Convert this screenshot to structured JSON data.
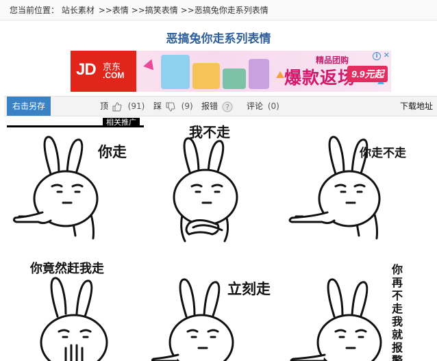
{
  "breadcrumb": {
    "prefix": "您当前位置：",
    "items": [
      "站长素材",
      ">>表情",
      ">>搞笑表情",
      ">>恶搞兔你走系列表情"
    ]
  },
  "page_title": "恶搞兔你走系列表情",
  "ad": {
    "brand_main": "JD",
    "brand_cn": "京东",
    "brand_com": ".COM",
    "slogan_small": "精品团购",
    "slogan_big": "爆款返场",
    "price": "9.9元起"
  },
  "toolbar": {
    "save_label": "右击另存",
    "like_label": "顶",
    "like_count": "(91)",
    "dislike_label": "踩",
    "dislike_count": "(9)",
    "report_label": "报错",
    "comment_label": "评论",
    "comment_count": "(0)",
    "download_label": "下载地址"
  },
  "related_tab": "相关推广",
  "memes": [
    {
      "caption": "你走"
    },
    {
      "caption": "我不走"
    },
    {
      "caption": "你走不走"
    },
    {
      "caption": "你竟然赶我走"
    },
    {
      "caption": "立刻走"
    },
    {
      "caption": "你再不走我就报警"
    }
  ],
  "colors": {
    "title": "#2f5f9a",
    "save_button": "#3a82c4",
    "jd_red": "#e1251b",
    "ad_pink": "#d4176a"
  }
}
